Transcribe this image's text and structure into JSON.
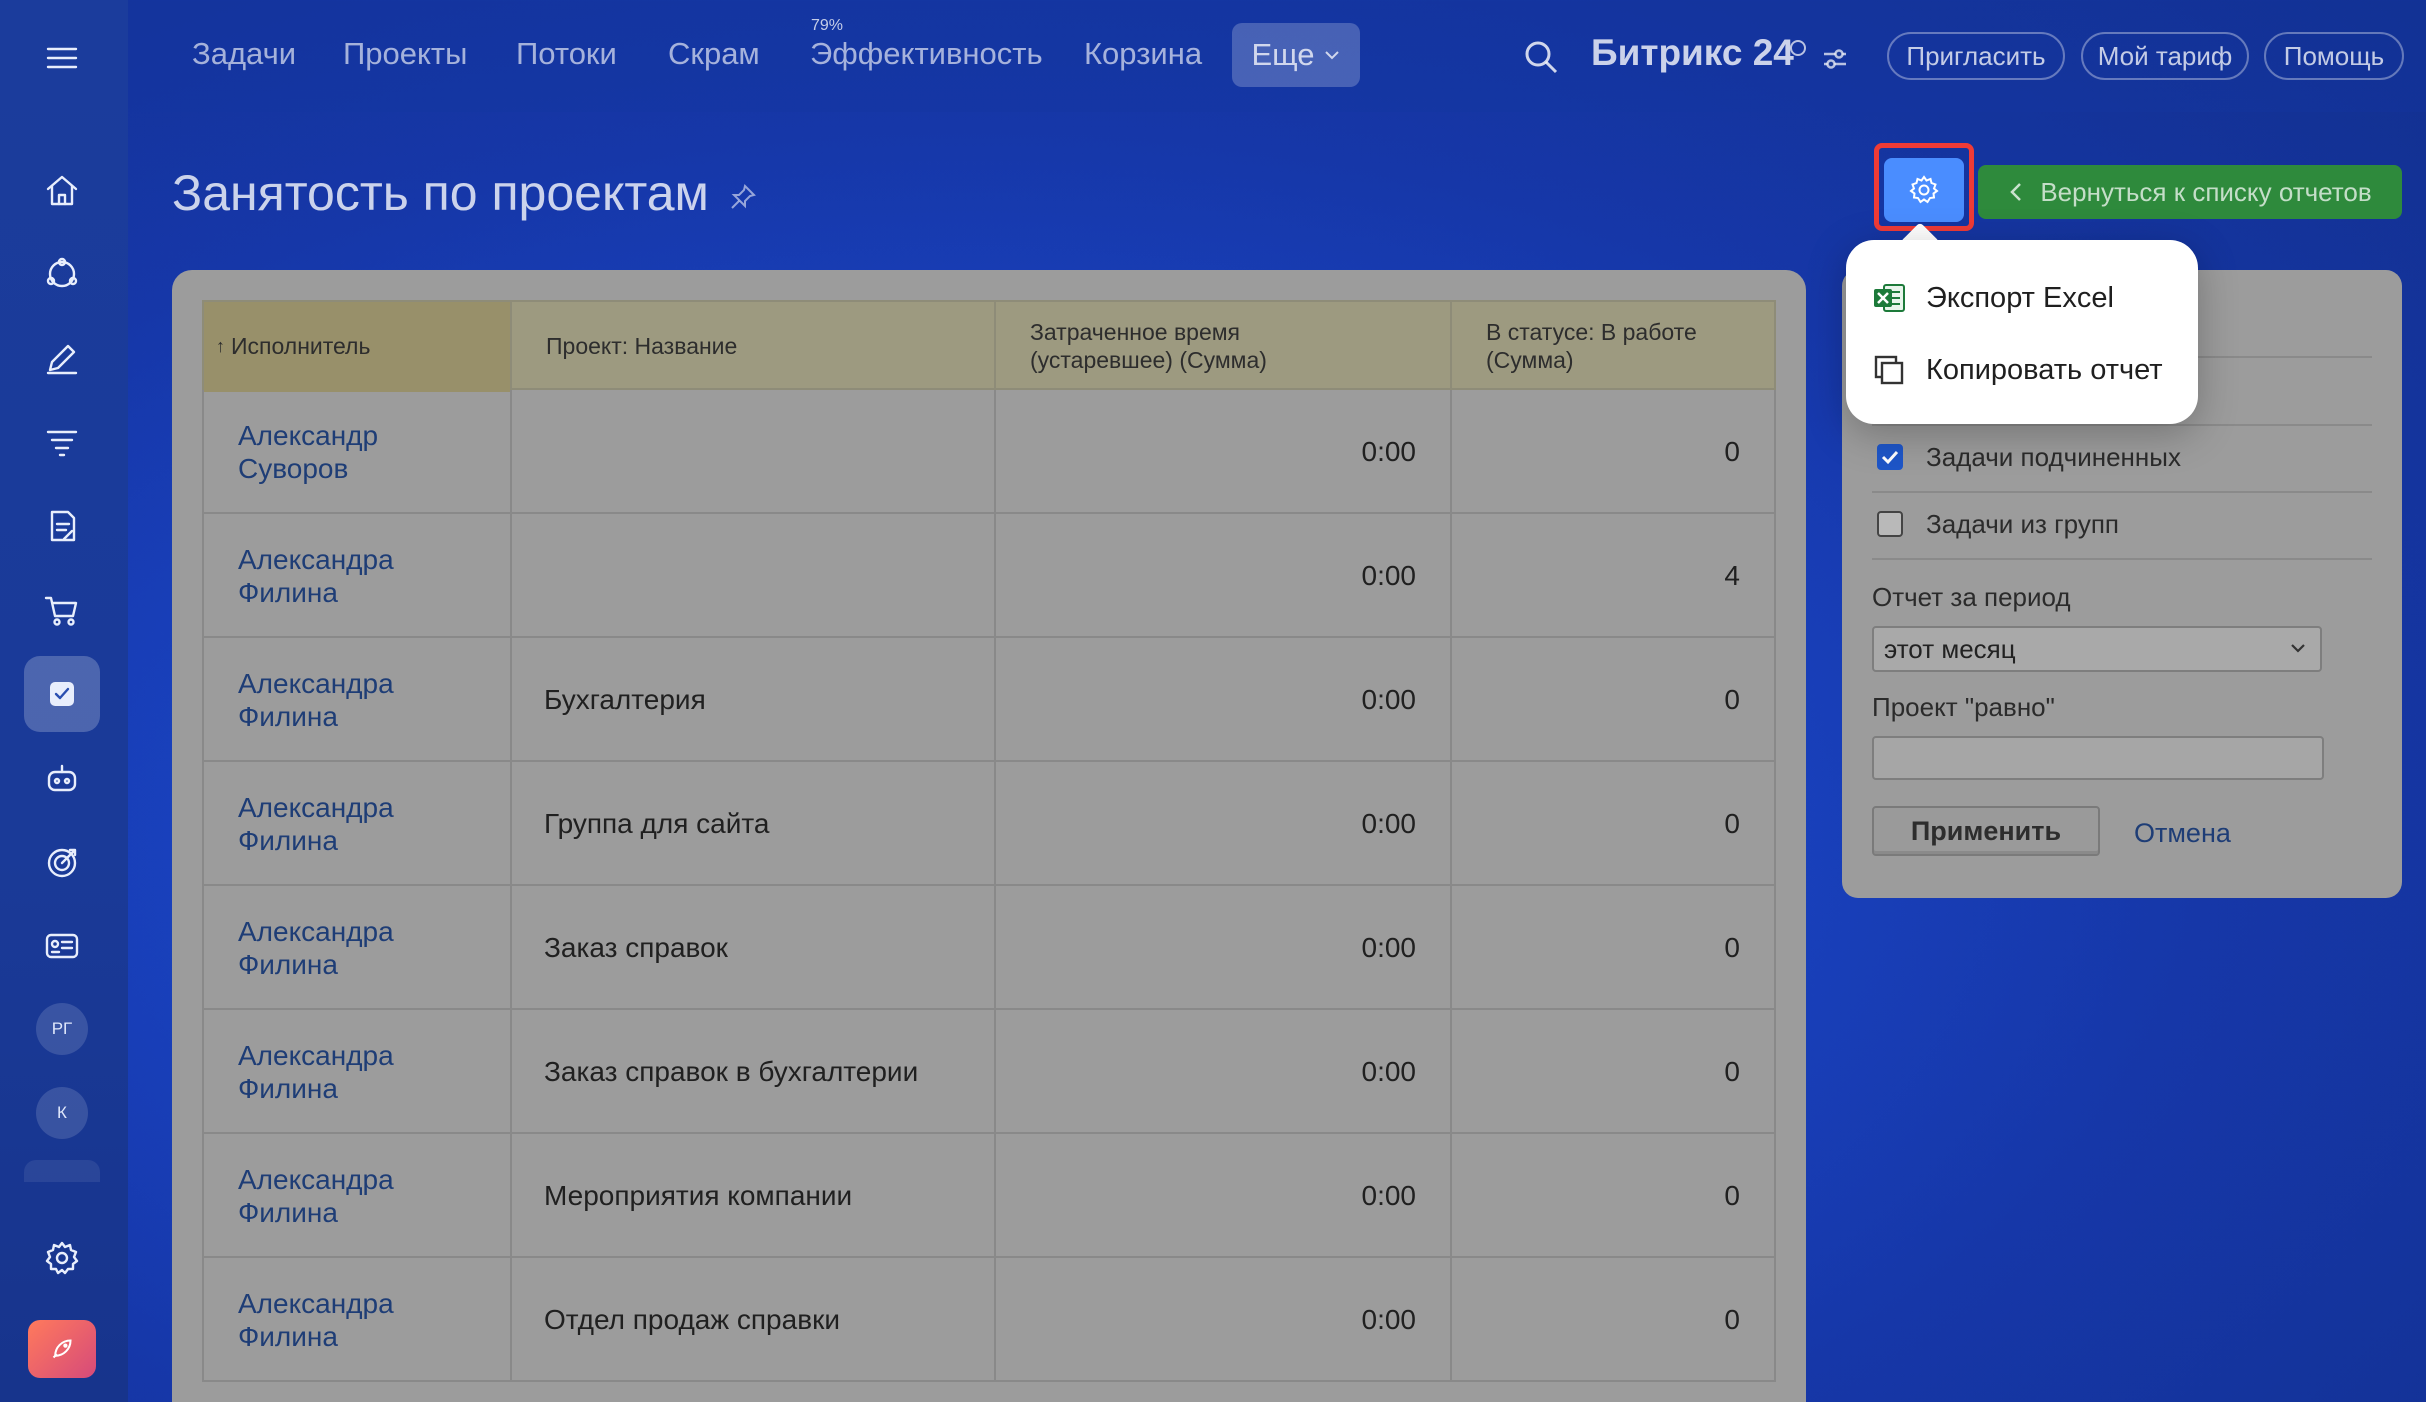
{
  "topnav": {
    "items": [
      "Задачи",
      "Проекты",
      "Потоки",
      "Скрам",
      "Эффективность",
      "Корзина"
    ],
    "efficiency_badge": "79%",
    "more_label": "Еще",
    "brand": "Битрикс 24",
    "invite_label": "Пригласить",
    "tariff_label": "Мой тариф",
    "help_label": "Помощь"
  },
  "sidebar": {
    "icons": [
      "home-icon",
      "crm-icon",
      "feed-icon",
      "funnel-icon",
      "document-icon",
      "cart-icon",
      "tasks-icon",
      "robot-icon",
      "target-icon",
      "contact-card-icon"
    ],
    "avatars": [
      "РГ",
      "К"
    ]
  },
  "page": {
    "title": "Занятость по проектам",
    "back_button": "Вернуться к списку отчетов"
  },
  "popup_menu": {
    "items": [
      "Экспорт Excel",
      "Копировать отчет"
    ]
  },
  "table": {
    "columns": [
      "Исполнитель",
      "Проект: Название",
      "Затраченное время (устаревшее) (Сумма)",
      "В статусе: В работе (Сумма)"
    ],
    "column_lines": [
      [
        "Исполнитель"
      ],
      [
        "Проект: Название"
      ],
      [
        "Затраченное время",
        "(устаревшее) (Сумма)"
      ],
      [
        "В статусе: В работе",
        "(Сумма)"
      ]
    ],
    "rows": [
      {
        "performer": [
          "Александр",
          "Суворов"
        ],
        "project": "",
        "time": "0:00",
        "in_progress": "0"
      },
      {
        "performer": [
          "Александра",
          "Филина"
        ],
        "project": "",
        "time": "0:00",
        "in_progress": "4"
      },
      {
        "performer": [
          "Александра",
          "Филина"
        ],
        "project": "Бухгалтерия",
        "time": "0:00",
        "in_progress": "0"
      },
      {
        "performer": [
          "Александра",
          "Филина"
        ],
        "project": "Группа для сайта",
        "time": "0:00",
        "in_progress": "0"
      },
      {
        "performer": [
          "Александра",
          "Филина"
        ],
        "project": "Заказ справок",
        "time": "0:00",
        "in_progress": "0"
      },
      {
        "performer": [
          "Александра",
          "Филина"
        ],
        "project": "Заказ справок в бухгалтерии",
        "time": "0:00",
        "in_progress": "0"
      },
      {
        "performer": [
          "Александра",
          "Филина"
        ],
        "project": "Мероприятия компании",
        "time": "0:00",
        "in_progress": "0"
      },
      {
        "performer": [
          "Александра",
          "Филина"
        ],
        "project": "Отдел продаж справки",
        "time": "0:00",
        "in_progress": "0"
      }
    ]
  },
  "filter": {
    "subordinates_label": "Задачи подчиненных",
    "subordinates_checked": true,
    "groups_label": "Задачи из групп",
    "groups_checked": false,
    "period_label": "Отчет за период",
    "period_value": "этот месяц",
    "project_label": "Проект \"равно\"",
    "project_value": "",
    "apply_label": "Применить",
    "cancel_label": "Отмена"
  },
  "colors": {
    "back_button": "#2e8a3c",
    "gear_button": "#4a8dff",
    "highlight": "#ef3b36"
  }
}
